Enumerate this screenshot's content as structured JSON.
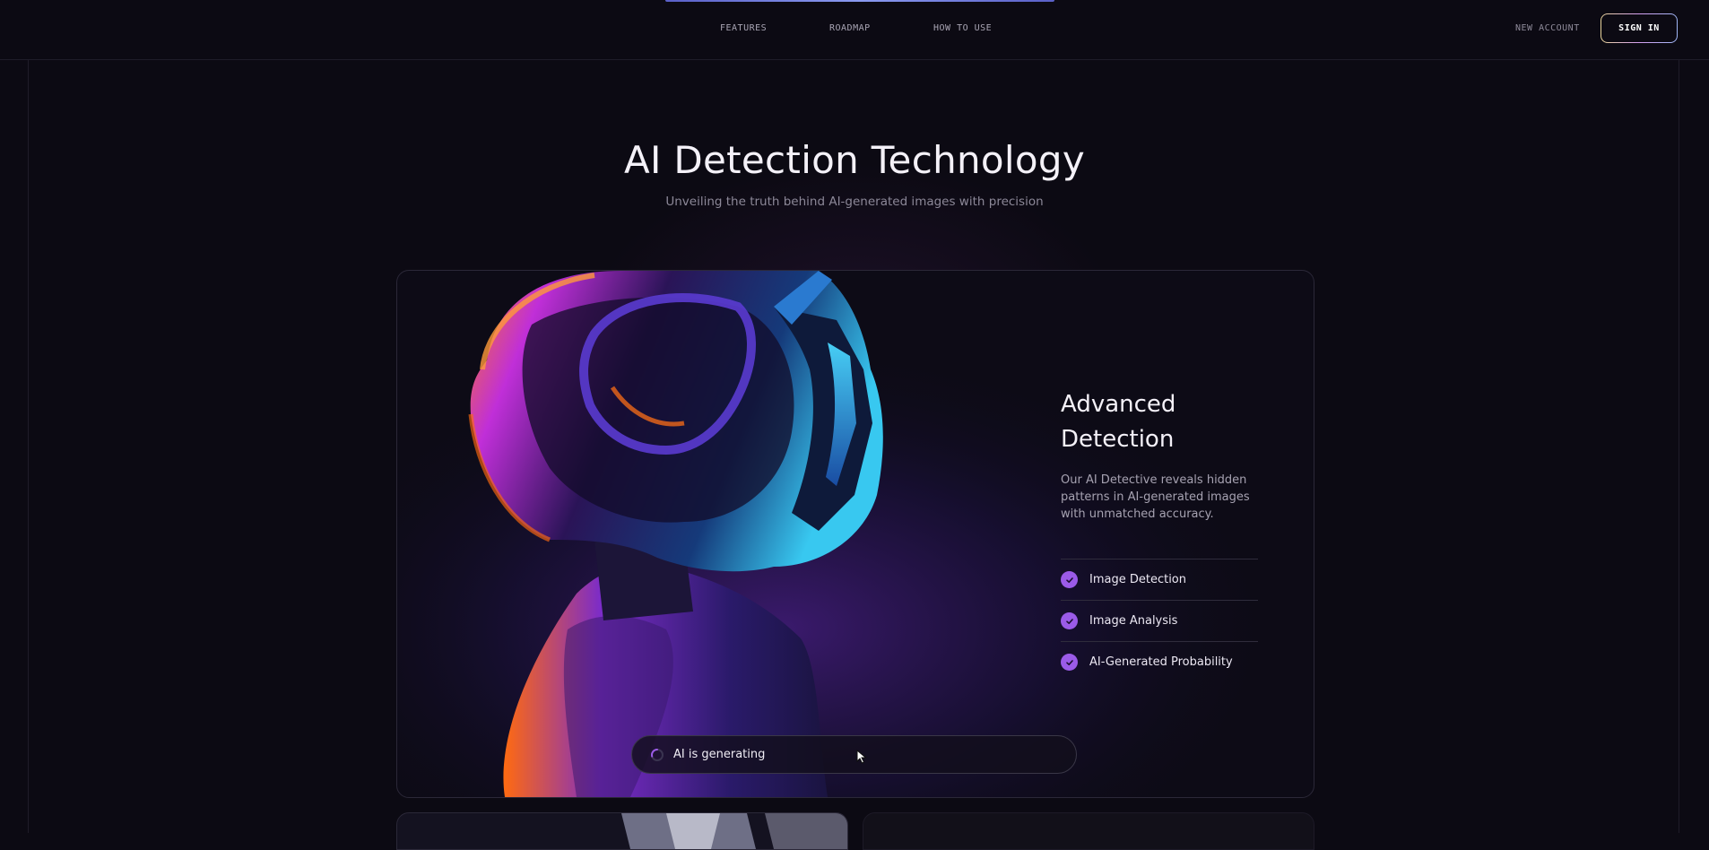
{
  "nav": {
    "links": [
      "FEATURES",
      "ROADMAP",
      "HOW TO USE"
    ],
    "new_account": "NEW ACCOUNT",
    "sign_in": "SIGN IN"
  },
  "hero": {
    "title": "AI Detection Technology",
    "subtitle": "Unveiling the truth behind AI-generated images with precision"
  },
  "feature_card": {
    "heading_line1": "Advanced",
    "heading_line2": "Detection",
    "description": "Our AI Detective reveals hidden patterns in AI-generated images with unmatched accuracy.",
    "features": [
      "Image Detection",
      "Image Analysis",
      "AI-Generated Probability"
    ],
    "status_text": "AI is generating",
    "image_subject": "helmet-profile-image"
  },
  "colors": {
    "background": "#0c0a13",
    "accent_purple": "#9b5be8",
    "text_muted": "#8c8898",
    "border": "#2b2838"
  },
  "icons": [
    "check-icon",
    "spinner-icon",
    "cursor-icon"
  ]
}
